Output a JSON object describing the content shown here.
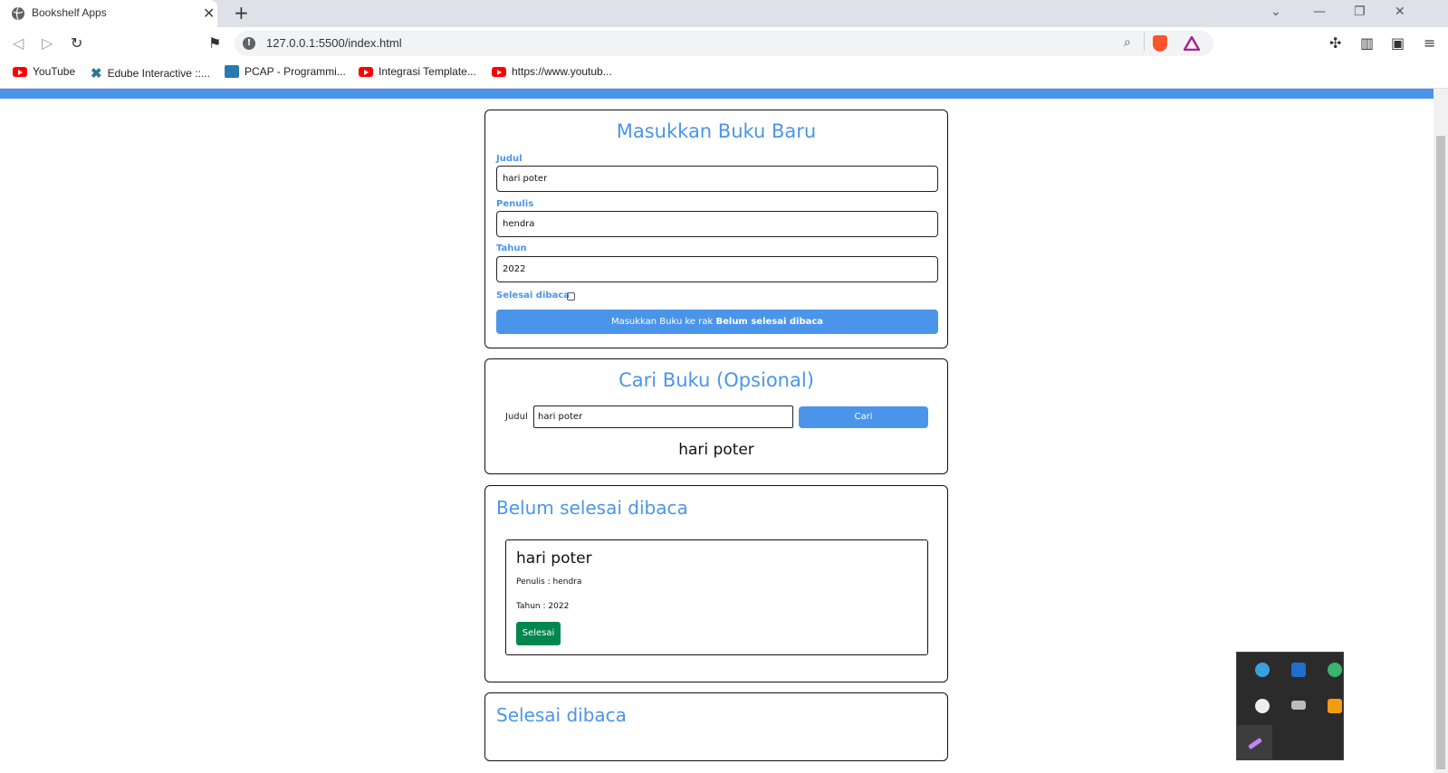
{
  "browser": {
    "tab_title": "Bookshelf Apps",
    "url": "127.0.0.1:5500/index.html",
    "bookmarks": [
      "YouTube",
      "Edube Interactive ::...",
      "PCAP - Programmi...",
      "Integrasi Template...",
      "https://www.youtub..."
    ]
  },
  "form": {
    "title": "Masukkan Buku Baru",
    "judul_label": "Judul",
    "judul_value": "hari poter",
    "penulis_label": "Penulis",
    "penulis_value": "hendra",
    "tahun_label": "Tahun",
    "tahun_value": "2022",
    "selesai_label": "Selesai dibaca",
    "submit_prefix": "Masukkan Buku ke rak",
    "submit_bold": "Belum selesai dibaca"
  },
  "search": {
    "title": "Cari Buku (Opsional)",
    "label": "Judul",
    "value": "hari poter",
    "button": "Cari",
    "result": "hari poter"
  },
  "unfinished": {
    "title": "Belum selesai dibaca",
    "books": [
      {
        "title": "hari poter",
        "author": "Penulis : hendra",
        "year": "Tahun : 2022",
        "action": "Selesai"
      }
    ]
  },
  "finished": {
    "title": "Selesai dibaca"
  },
  "colors": {
    "accent": "#4a95e9",
    "green": "#00874e"
  }
}
